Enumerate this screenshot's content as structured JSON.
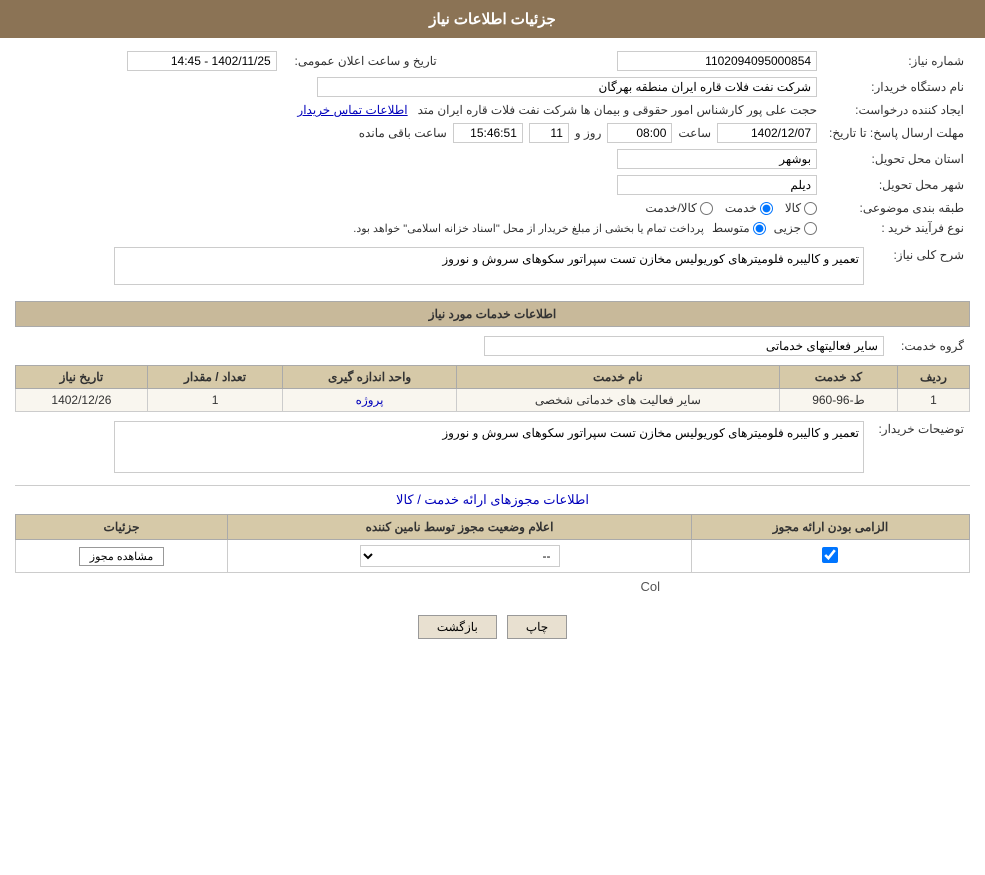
{
  "header": {
    "title": "جزئیات اطلاعات نیاز"
  },
  "fields": {
    "shomare_niaz_label": "شماره نیاز:",
    "shomare_niaz_value": "1102094095000854",
    "nam_dastgah_label": "نام دستگاه خریدار:",
    "nam_dastgah_value": "شرکت نفت فلات قاره ایران منطقه بهرگان",
    "tarikh_label": "تاریخ و ساعت اعلان عمومی:",
    "tarikh_value": "1402/11/25 - 14:45",
    "ijad_label": "ایجاد کننده درخواست:",
    "ijad_value": "حجت علی پور کارشناس امور حقوقی و بیمان ها شرکت نفت فلات قاره ایران متد",
    "ijad_link": "اطلاعات تماس خریدار",
    "mohlet_label": "مهلت ارسال پاسخ: تا تاریخ:",
    "mohlet_date": "1402/12/07",
    "mohlet_time": "08:00",
    "mohlet_day": "11",
    "mohlet_remain": "15:46:51",
    "mohlet_remain_label": "ساعت باقی مانده",
    "ostan_label": "استان محل تحویل:",
    "ostan_value": "بوشهر",
    "shahr_label": "شهر محل تحویل:",
    "shahr_value": "دیلم",
    "tabaqe_label": "طبقه بندی موضوعی:",
    "tabaqe_kala": "کالا",
    "tabaqe_khadamat": "خدمت",
    "tabaqe_kala_khadamat": "کالا/خدمت",
    "noe_farayand_label": "نوع فرآیند خرید :",
    "noe_jozi": "جزیی",
    "noe_motavaset": "متوسط",
    "noe_description": "پرداخت تمام یا بخشی از مبلغ خریدار از محل \"اسناد خزانه اسلامی\" خواهد بود.",
    "sharh_label": "شرح کلی نیاز:",
    "sharh_value": "تعمیر و کالیبره فلومیترهای کوریولیس مخازن تست سپراتور سکوهای سروش و نوروز",
    "section_khadamat": "اطلاعات خدمات مورد نیاز",
    "gorohe_khadamat_label": "گروه خدمت:",
    "gorohe_khadamat_value": "سایر فعالیتهای خدماتی",
    "table_headers": {
      "radif": "ردیف",
      "kod_khadamat": "کد خدمت",
      "nam_khadamat": "نام خدمت",
      "vahad": "واحد اندازه گیری",
      "tedad": "تعداد / مقدار",
      "tarikh_niaz": "تاریخ نیاز"
    },
    "table_rows": [
      {
        "radif": "1",
        "kod": "ط-96-960",
        "nam": "سایر فعالیت های خدماتی شخصی",
        "vahad": "پروژه",
        "tedad": "1",
        "tarikh": "1402/12/26"
      }
    ],
    "tosaif_label": "توضیحات خریدار:",
    "tosaif_value": "تعمیر و کالیبره فلومیترهای کوریولیس مخازن تست سپراتور سکوهای سروش و نوروز",
    "section_mojoz": "اطلاعات مجوزهای ارائه خدمت / کالا",
    "perm_table": {
      "headers": {
        "elzam": "الزامی بودن ارائه مجوز",
        "alam": "اعلام وضعیت مجوز توسط نامین کننده",
        "joziat": "جزئیات"
      },
      "rows": [
        {
          "elzam_checked": true,
          "alam_value": "--",
          "joziat_label": "مشاهده مجوز"
        }
      ]
    },
    "col_text": "Col",
    "btn_print": "چاپ",
    "btn_back": "بازگشت"
  }
}
